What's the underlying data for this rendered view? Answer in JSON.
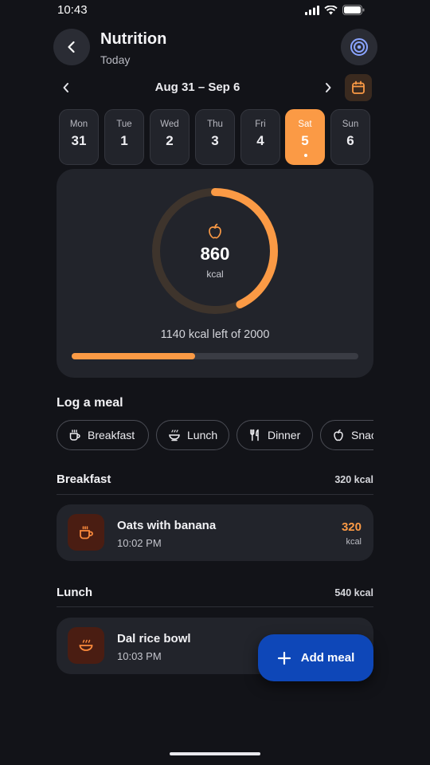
{
  "status_bar": {
    "time": "10:43"
  },
  "header": {
    "title": "Nutrition",
    "subtitle": "Today"
  },
  "week": {
    "range": "Aug 31 – Sep 6",
    "days": [
      {
        "name": "Mon",
        "num": "31"
      },
      {
        "name": "Tue",
        "num": "1"
      },
      {
        "name": "Wed",
        "num": "2"
      },
      {
        "name": "Thu",
        "num": "3"
      },
      {
        "name": "Fri",
        "num": "4"
      },
      {
        "name": "Sat",
        "num": "5"
      },
      {
        "name": "Sun",
        "num": "6"
      }
    ],
    "selected_index": 5
  },
  "summary": {
    "consumed": "860",
    "unit": "kcal",
    "left_text": "1140 kcal left of 2000",
    "goal": 2000,
    "consumed_value": 860
  },
  "log_meal": {
    "title": "Log a meal",
    "chips": [
      {
        "label": "Breakfast",
        "icon": "coffee-cup-icon"
      },
      {
        "label": "Lunch",
        "icon": "bowl-icon"
      },
      {
        "label": "Dinner",
        "icon": "fork-knife-icon"
      },
      {
        "label": "Snack",
        "icon": "apple-icon"
      }
    ]
  },
  "meals": {
    "breakfast": {
      "label": "Breakfast",
      "total": "320 kcal",
      "items": [
        {
          "name": "Oats with banana",
          "time": "10:02 PM",
          "kcal": "320",
          "unit": "kcal",
          "icon": "coffee-cup-icon"
        }
      ]
    },
    "lunch": {
      "label": "Lunch",
      "total": "540 kcal",
      "items": [
        {
          "name": "Dal rice bowl",
          "time": "10:03 PM",
          "icon": "bowl-icon"
        }
      ]
    }
  },
  "fab": {
    "label": "Add meal",
    "icon": "plus-icon"
  },
  "colors": {
    "accent": "#fb9a45",
    "background": "#121318",
    "card": "#22242b",
    "fab": "#0e47b8"
  }
}
